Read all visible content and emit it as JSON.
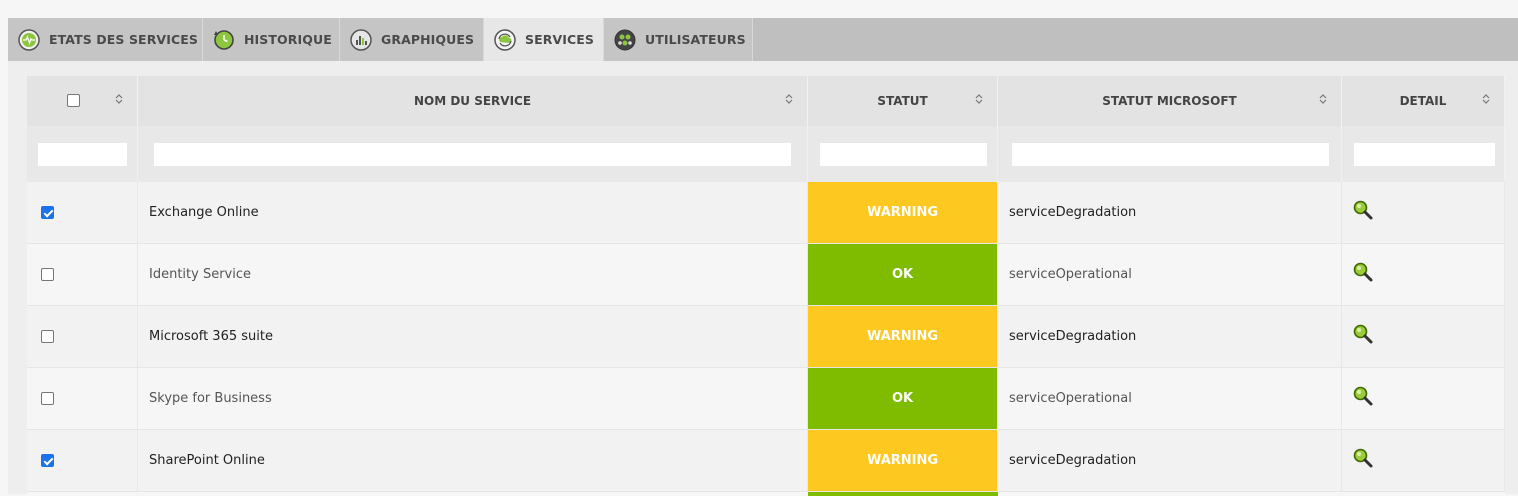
{
  "tabs": [
    {
      "label": "ETATS DES SERVICES",
      "icon": "heartbeat-icon"
    },
    {
      "label": "HISTORIQUE",
      "icon": "history-clock-icon"
    },
    {
      "label": "GRAPHIQUES",
      "icon": "bar-chart-icon"
    },
    {
      "label": "SERVICES",
      "icon": "cloud-sync-icon"
    },
    {
      "label": "UTILISATEURS",
      "icon": "users-icon"
    }
  ],
  "active_tab": "SERVICES",
  "table": {
    "columns": [
      "",
      "NOM DU SERVICE",
      "STATUT",
      "STATUT MICROSOFT",
      "DETAIL"
    ],
    "rows": [
      {
        "checked": true,
        "name": "Exchange Online",
        "status": "WARNING",
        "ms_status": "serviceDegradation"
      },
      {
        "checked": false,
        "name": "Identity Service",
        "status": "OK",
        "ms_status": "serviceOperational"
      },
      {
        "checked": false,
        "name": "Microsoft 365 suite",
        "status": "WARNING",
        "ms_status": "serviceDegradation"
      },
      {
        "checked": false,
        "name": "Skype for Business",
        "status": "OK",
        "ms_status": "serviceOperational"
      },
      {
        "checked": true,
        "name": "SharePoint Online",
        "status": "WARNING",
        "ms_status": "serviceDegradation"
      }
    ]
  },
  "colors": {
    "warning": "#fdc81f",
    "ok": "#7fbc00",
    "tab_icon_green": "#8cc63f",
    "checkbox_blue": "#1a73e8"
  }
}
